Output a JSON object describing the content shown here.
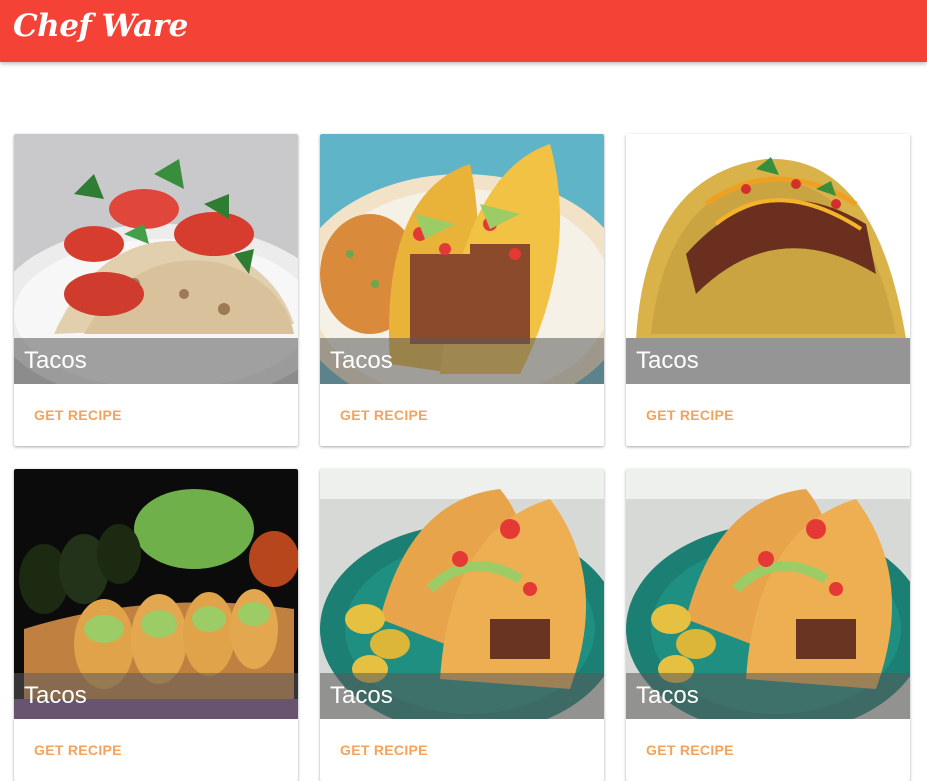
{
  "app": {
    "title": "Chef Ware",
    "brand_color": "#f44336",
    "accent_color": "#f4a35c"
  },
  "cards": [
    {
      "title": "Tacos",
      "action_label": "GET RECIPE",
      "image": "soft-tacos-tomato-cilantro-photo"
    },
    {
      "title": "Tacos",
      "action_label": "GET RECIPE",
      "image": "hard-shell-tacos-rice-plate-photo"
    },
    {
      "title": "Tacos",
      "action_label": "GET RECIPE",
      "image": "single-hard-shell-taco-photo"
    },
    {
      "title": "Tacos",
      "action_label": "GET RECIPE",
      "image": "taco-platter-avocado-photo"
    },
    {
      "title": "Tacos",
      "action_label": "GET RECIPE",
      "image": "tacos-green-plate-photo"
    },
    {
      "title": "Tacos",
      "action_label": "GET RECIPE",
      "image": "tacos-green-plate-photo"
    }
  ]
}
